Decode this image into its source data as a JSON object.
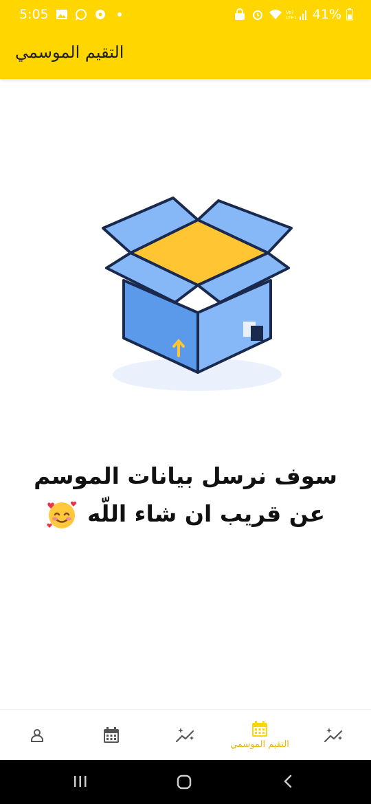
{
  "status_bar": {
    "time": "5:05",
    "battery": "41%",
    "network_label": "Vo) LTE1"
  },
  "header": {
    "title": "التقيم الموسمي",
    "background_color": "#FFD600"
  },
  "content": {
    "message_line1": "سوف نرسل بيانات الموسم",
    "message_line2": "عن قريب ان شاء اللّه",
    "illustration": "empty-box-icon"
  },
  "bottom_nav": {
    "items": [
      {
        "icon": "profile-icon",
        "label": ""
      },
      {
        "icon": "calendar-icon",
        "label": ""
      },
      {
        "icon": "sparkle-chart-icon",
        "label": ""
      },
      {
        "icon": "calendar-icon",
        "label": "التقيم الموسمي",
        "active": true
      },
      {
        "icon": "sparkle-chart-icon",
        "label": ""
      }
    ],
    "active_color": "#FFD600"
  }
}
